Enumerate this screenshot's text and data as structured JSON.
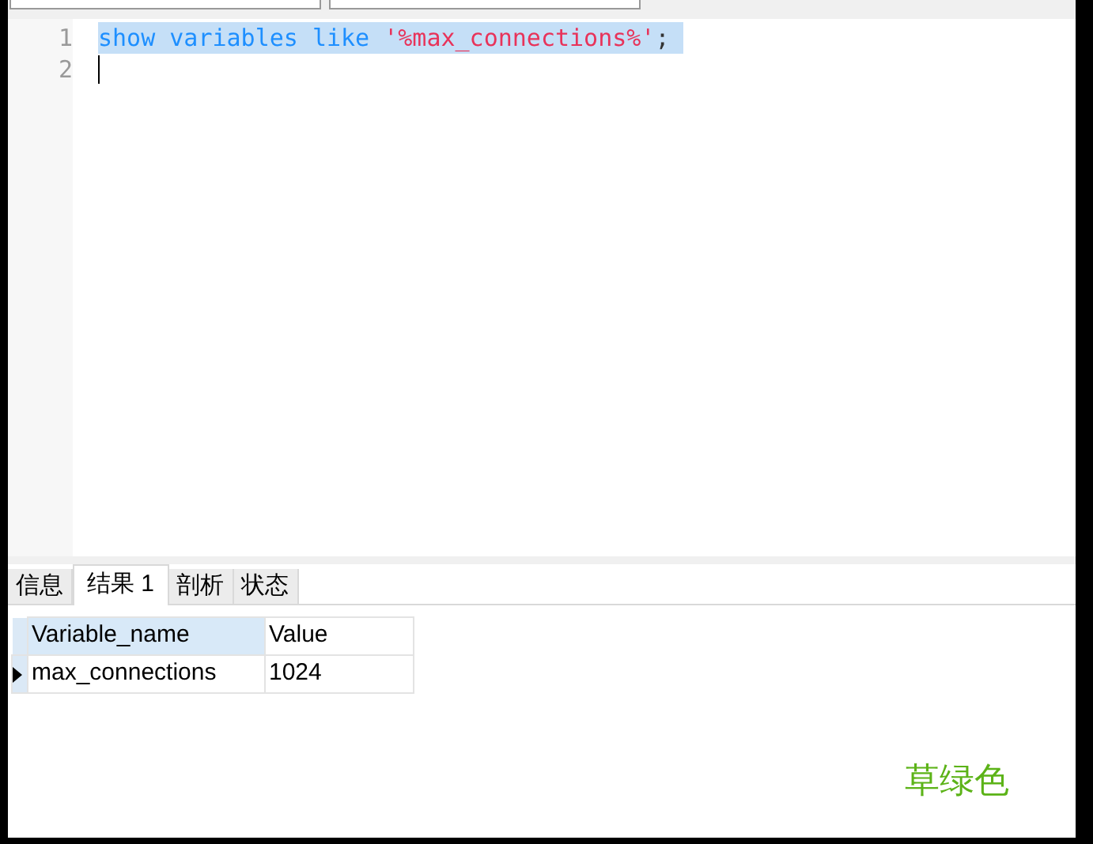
{
  "editor": {
    "lines": [
      {
        "number": "1",
        "selected": true,
        "tokens": [
          {
            "kind": "keyword",
            "text": "show variables like"
          },
          {
            "kind": "string",
            "text": "'%max_connections%'"
          },
          {
            "kind": "plain",
            "text": ";"
          }
        ]
      },
      {
        "number": "2",
        "cursor": true
      }
    ]
  },
  "tabs": [
    {
      "label": "信息",
      "selected": false
    },
    {
      "label": "结果 1",
      "selected": true
    },
    {
      "label": "剖析",
      "selected": false
    },
    {
      "label": "状态",
      "selected": false
    }
  ],
  "table": {
    "columns": [
      "Variable_name",
      "Value"
    ],
    "rows": [
      {
        "current": true,
        "cells": [
          "max_connections",
          "1024"
        ]
      }
    ]
  },
  "annotation": {
    "text": "草绿色",
    "color": "#5cb318"
  }
}
